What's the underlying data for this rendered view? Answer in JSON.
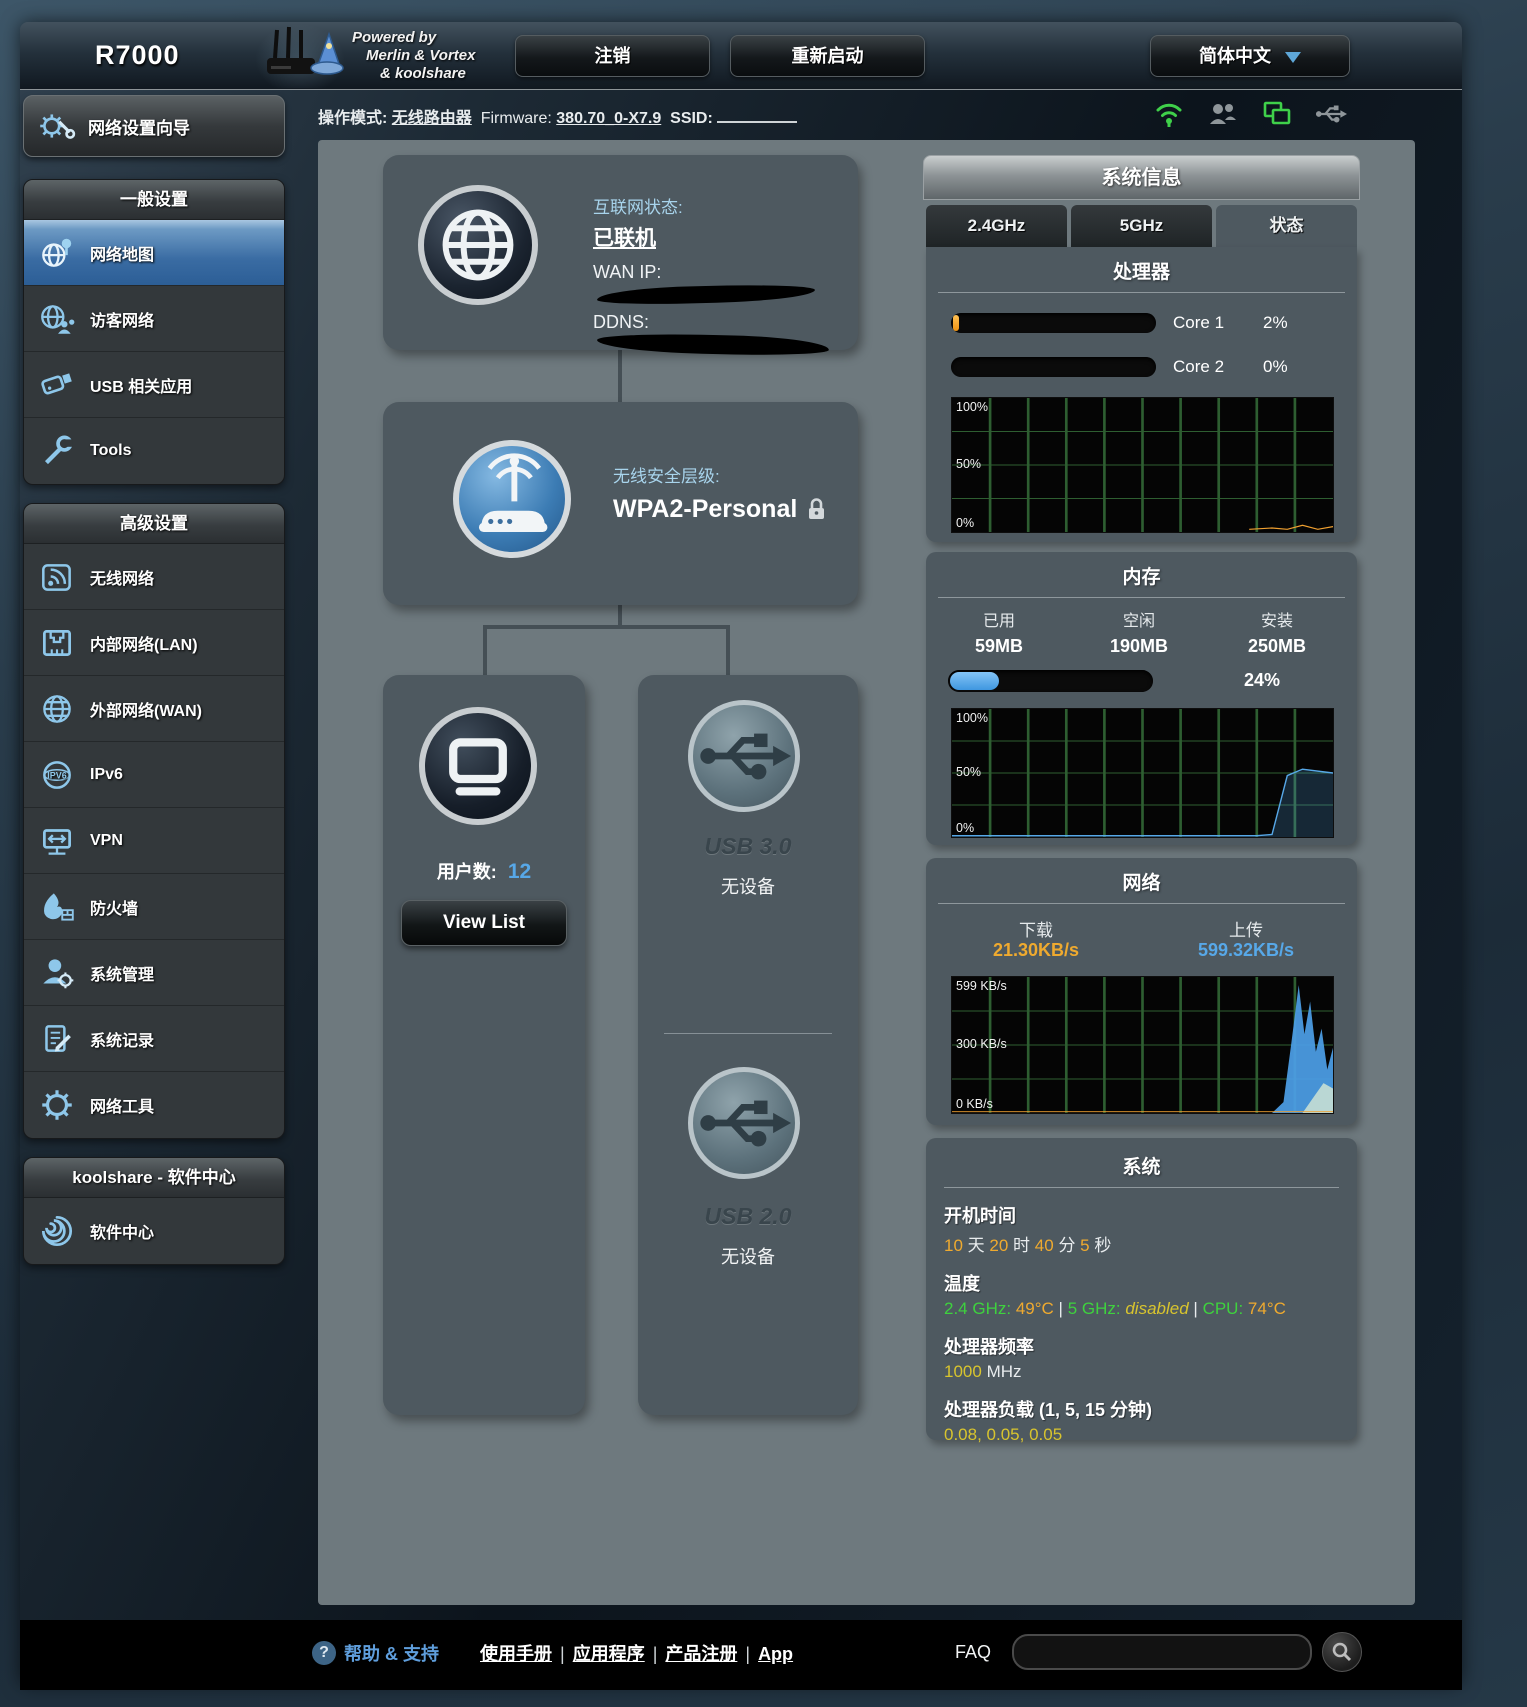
{
  "header": {
    "device": "R7000",
    "brand_line1": "Powered by",
    "brand_line2": "Merlin & Vortex",
    "brand_line3": "& koolshare",
    "logout": "注销",
    "reboot": "重新启动",
    "language": "简体中文"
  },
  "infobar": {
    "op_label": "操作模式:",
    "op_value": "无线路由器",
    "fw_label": "Firmware:",
    "fw_value": "380.70_0-X7.9",
    "ssid_label": "SSID:"
  },
  "sidebar": {
    "wizard": "网络设置向导",
    "general_header": "一般设置",
    "general_items": [
      "网络地图",
      "访客网络",
      "USB 相关应用",
      "Tools"
    ],
    "advanced_header": "高级设置",
    "advanced_items": [
      "无线网络",
      "内部网络(LAN)",
      "外部网络(WAN)",
      "IPv6",
      "VPN",
      "防火墙",
      "系统管理",
      "系统记录",
      "网络工具"
    ],
    "koolshare_header": "koolshare - 软件中心",
    "koolshare_items": [
      "软件中心"
    ]
  },
  "map": {
    "internet": {
      "status_label": "互联网状态:",
      "status_value": "已联机",
      "wan_label": "WAN IP:",
      "ddns_label": "DDNS:"
    },
    "security": {
      "label": "无线安全层级:",
      "value": "WPA2-Personal"
    },
    "clients": {
      "label": "用户数:",
      "count": "12",
      "button": "View List"
    },
    "usb3": {
      "name": "USB 3.0",
      "status": "无设备"
    },
    "usb2": {
      "name": "USB 2.0",
      "status": "无设备"
    }
  },
  "sysinfo": {
    "title": "系统信息",
    "tabs": [
      "2.4GHz",
      "5GHz",
      "状态"
    ],
    "cpu": {
      "title": "处理器",
      "core1_label": "Core 1",
      "core1_value": "2%",
      "core2_label": "Core 2",
      "core2_value": "0%",
      "y100": "100%",
      "y50": "50%",
      "y0": "0%"
    },
    "memory": {
      "title": "内存",
      "used_label": "已用",
      "used_value": "59MB",
      "free_label": "空闲",
      "free_value": "190MB",
      "total_label": "安装",
      "total_value": "250MB",
      "percent": "24%",
      "y100": "100%",
      "y50": "50%",
      "y0": "0%"
    },
    "network": {
      "title": "网络",
      "down_label": "下载",
      "down_value": "21.30KB/s",
      "up_label": "上传",
      "up_value": "599.32KB/s",
      "y100": "599 KB/s",
      "y50": "300 KB/s",
      "y0": "0 KB/s"
    },
    "system": {
      "title": "系统",
      "uptime_label": "开机时间",
      "up_d": "10",
      "up_d_u": "天",
      "up_h": "20",
      "up_h_u": "时",
      "up_m": "40",
      "up_m_u": "分",
      "up_s": "5",
      "up_s_u": "秒",
      "temp_label": "温度",
      "t24_label": "2.4 GHz:",
      "t24_value": "49°C",
      "sep": "|",
      "t5_label": "5 GHz:",
      "t5_value": "disabled",
      "tcpu_label": "CPU:",
      "tcpu_value": "74°C",
      "freq_label": "处理器频率",
      "freq_value": "1000",
      "freq_unit": "MHz",
      "load_label": "处理器负载 (1, 5, 15 分钟)",
      "load_value": "0.08,  0.05,  0.05"
    }
  },
  "footer": {
    "help": "帮助 & 支持",
    "link1": "使用手册",
    "link2": "应用程序",
    "link3": "产品注册",
    "link4": "App",
    "sep": "|",
    "faq": "FAQ"
  },
  "colors": {
    "accent_blue": "#57a8e8",
    "accent_orange": "#efaa2f",
    "status_green": "#3fd04a"
  }
}
